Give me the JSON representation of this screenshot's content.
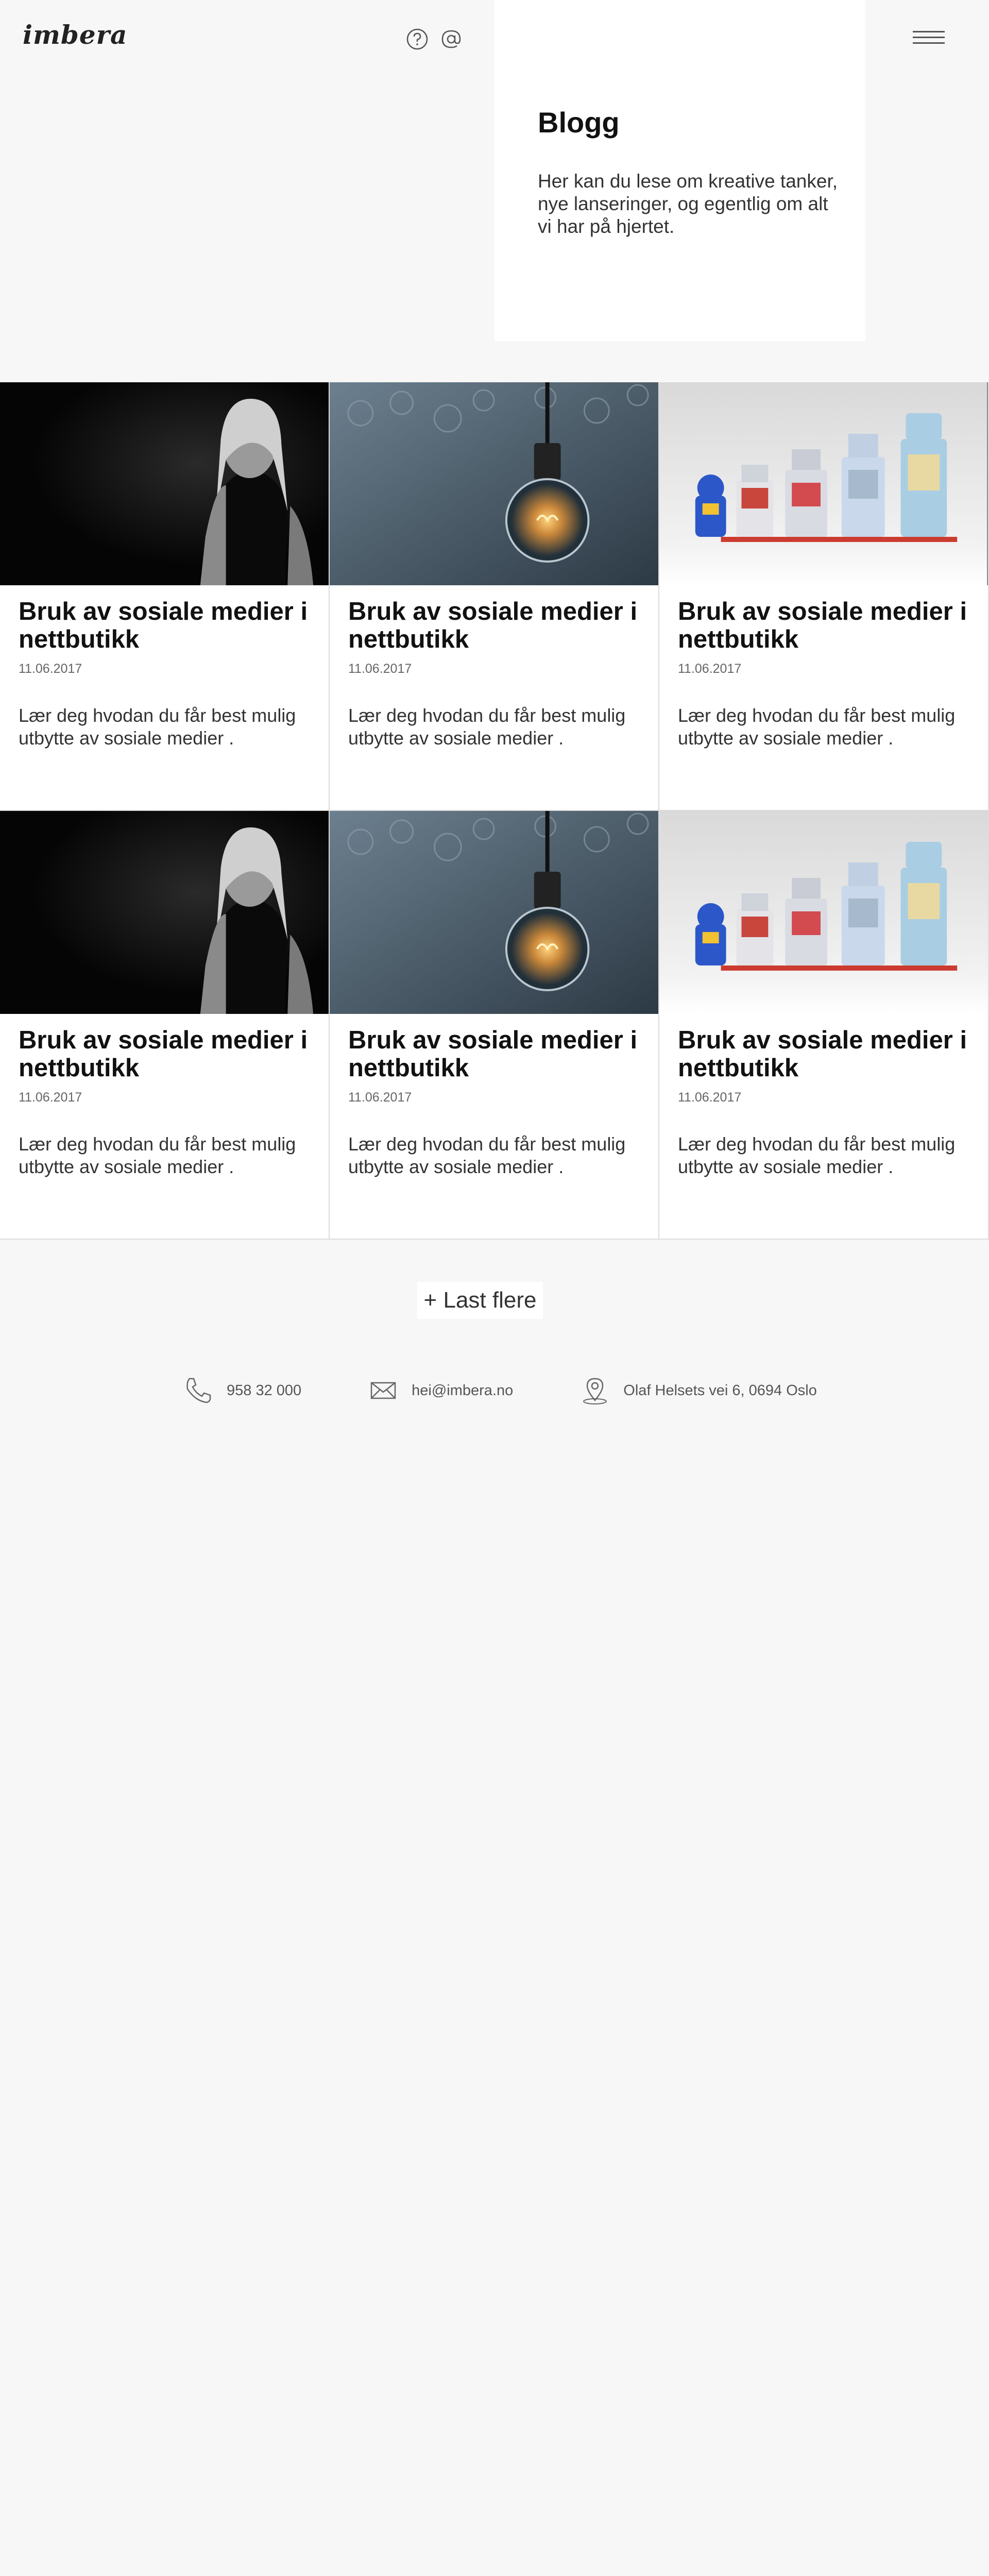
{
  "header": {
    "logo": "imbera",
    "help_icon": "help-circle-icon",
    "contact_icon": "at-sign-icon",
    "menu_icon": "hamburger-menu-icon"
  },
  "intro": {
    "title": "Blogg",
    "text": "Her kan du lese om kreative tanker, nye lanseringer, og egentlig om alt vi har på hjertet."
  },
  "posts": [
    {
      "image": "woman-portrait-image",
      "title": "Bruk av sosiale medier i nettbutikk",
      "date": "11.06.2017",
      "excerpt": "Lær deg hvodan du får best mulig utbytte av sosiale medier ."
    },
    {
      "image": "lightbulb-image",
      "title": "Bruk av sosiale medier i nettbutikk",
      "date": "11.06.2017",
      "excerpt": "Lær deg hvodan du får best mulig utbytte av sosiale medier ."
    },
    {
      "image": "toy-robots-image",
      "title": "Bruk av sosiale medier i nettbutikk",
      "date": "11.06.2017",
      "excerpt": "Lær deg hvodan du får best mulig utbytte av sosiale medier ."
    },
    {
      "image": "woman-portrait-image",
      "title": "Bruk av sosiale medier i nettbutikk",
      "date": "11.06.2017",
      "excerpt": "Lær deg hvodan du får best mulig utbytte av sosiale medier ."
    },
    {
      "image": "lightbulb-image",
      "title": "Bruk av sosiale medier i nettbutikk",
      "date": "11.06.2017",
      "excerpt": "Lær deg hvodan du får best mulig utbytte av sosiale medier ."
    },
    {
      "image": "toy-robots-image",
      "title": "Bruk av sosiale medier i nettbutikk",
      "date": "11.06.2017",
      "excerpt": "Lær deg hvodan du får best mulig utbytte av sosiale medier ."
    }
  ],
  "load_more": "+ Last flere",
  "contact": {
    "phone": "958 32 000",
    "email": "hei@imbera.no",
    "address": "Olaf Helsets vei 6, 0694 Oslo",
    "phone_icon": "phone-icon",
    "email_icon": "envelope-icon",
    "address_icon": "map-pin-icon"
  },
  "colors": {
    "background": "#f7f7f7",
    "card": "#ffffff",
    "text": "#111111",
    "muted": "#666666"
  }
}
